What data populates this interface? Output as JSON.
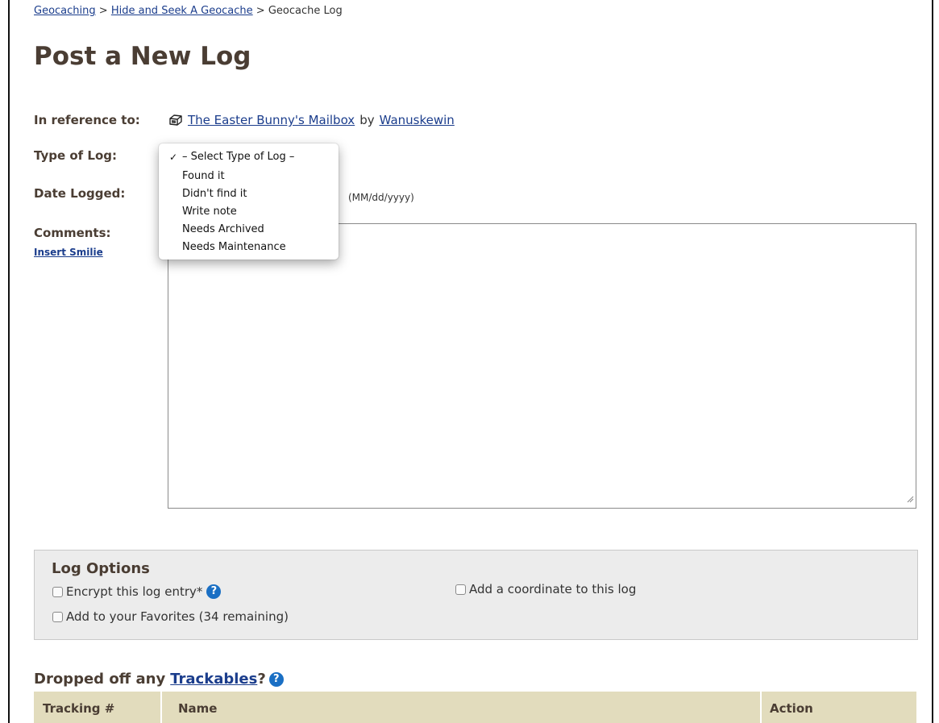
{
  "breadcrumb": {
    "items": [
      "Geocaching",
      "Hide and Seek A Geocache",
      "Geocache Log"
    ],
    "separator": ">"
  },
  "page_title": "Post a New Log",
  "form": {
    "reference_label": "In reference to:",
    "cache_name": "The Easter Bunny's Mailbox",
    "by_text": "by",
    "owner": "Wanuskewin",
    "type_label": "Type of Log:",
    "date_label": "Date Logged:",
    "date_hint": "(MM/dd/yyyy)",
    "comments_label": "Comments:",
    "insert_smilie": "Insert Smilie",
    "comments_value": ""
  },
  "log_type_dropdown": {
    "selected_index": 0,
    "check_glyph": "✓",
    "options": [
      "– Select Type of Log –",
      "Found it",
      "Didn't find it",
      "Write note",
      "Needs Archived",
      "Needs Maintenance"
    ]
  },
  "log_options": {
    "title": "Log Options",
    "encrypt_label": "Encrypt this log entry*",
    "favorites_label": "Add to your Favorites (34 remaining)",
    "coordinate_label": "Add a coordinate to this log",
    "help_glyph": "?"
  },
  "trackables": {
    "title_prefix": "Dropped off any",
    "link": "Trackables",
    "title_suffix": "?",
    "columns": [
      "Tracking #",
      "Name",
      "Action"
    ]
  },
  "colors": {
    "heading_brown": "#4a3d33",
    "link_blue": "#1b3d8c",
    "help_blue": "#1a6fc4",
    "options_panel_bg": "#ececec",
    "table_header_bg": "#e2dcbd"
  },
  "icons": [
    "cache-type-icon",
    "help-icon",
    "resize-grip-icon",
    "checkmark-icon"
  ]
}
